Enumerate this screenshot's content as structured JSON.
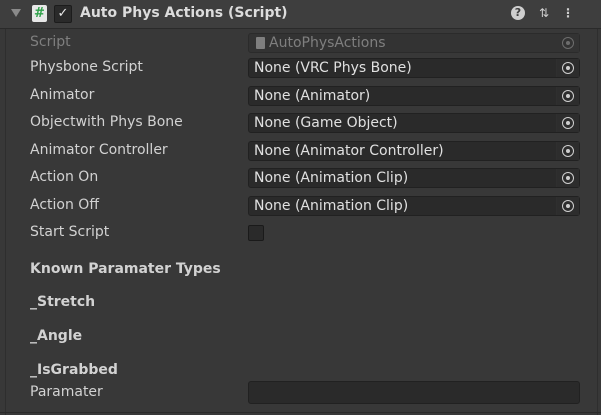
{
  "header": {
    "title": "Auto Phys Actions (Script)",
    "script_icon_glyph": "#",
    "enabled_check_glyph": "✓",
    "help_glyph": "?",
    "presets_glyph": "⇅",
    "menu_glyph": "⋮",
    "enabled": true
  },
  "fields": [
    {
      "label": "Script",
      "value": "AutoPhysActions",
      "disabled": true
    },
    {
      "label": "Physbone Script",
      "value": "None (VRC Phys Bone)"
    },
    {
      "label": "Animator",
      "value": "None (Animator)"
    },
    {
      "label": "Objectwith Phys Bone",
      "value": "None (Game Object)"
    },
    {
      "label": "Animator Controller",
      "value": "None (Animator Controller)"
    },
    {
      "label": "Action On",
      "value": "None (Animation Clip)"
    },
    {
      "label": "Action Off",
      "value": "None (Animation Clip)"
    }
  ],
  "start_script": {
    "label": "Start Script",
    "checked": false
  },
  "sections": {
    "known_types": "Known Paramater Types",
    "stretch": "_Stretch",
    "angle": "_Angle",
    "is_grabbed": "_IsGrabbed"
  },
  "paramater": {
    "label": "Paramater",
    "value": ""
  },
  "colors": {
    "background": "#383838",
    "header": "#3e3e3e",
    "field": "#2a2a2a",
    "text": "#d2d2d2",
    "disabled_text": "#7f7f7f",
    "script_icon_accent": "#2fa14a"
  }
}
